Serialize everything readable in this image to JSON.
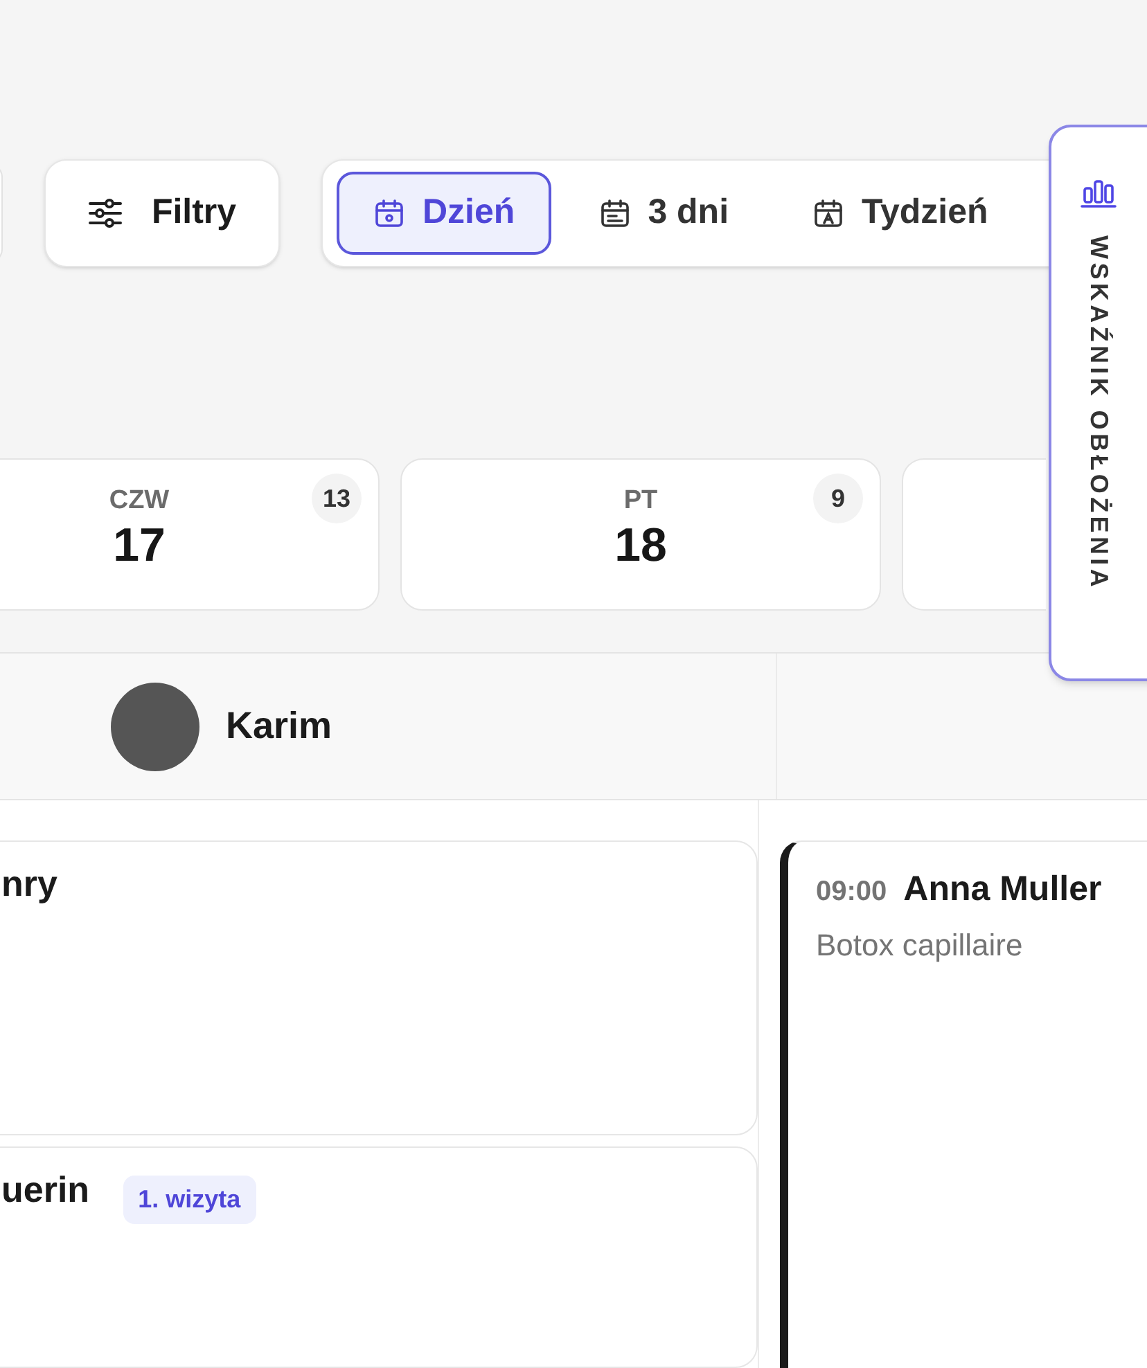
{
  "toolbar": {
    "filter_button": {
      "label": "Filtry"
    },
    "view_tabs": [
      {
        "label": "Dzień",
        "kind": "day",
        "selected": true
      },
      {
        "label": "3 dni",
        "kind": "range",
        "selected": false
      },
      {
        "label": "Tydzień",
        "kind": "week",
        "selected": false
      }
    ]
  },
  "occupancy_tab": {
    "label": "WSKAŹNIK OBŁOŻENIA"
  },
  "days": [
    {
      "weekday": "CZW",
      "date": "17",
      "count": "13"
    },
    {
      "weekday": "PT",
      "date": "18",
      "count": "9"
    }
  ],
  "staff": [
    {
      "name": "Karim"
    }
  ],
  "appointments": {
    "column_1": [
      {
        "client": "nry"
      },
      {
        "client": "uerin",
        "badge": "1. wizyta"
      }
    ],
    "column_2": [
      {
        "time": "09:00",
        "client": "Anna Muller",
        "service": "Botox capillaire"
      }
    ]
  }
}
